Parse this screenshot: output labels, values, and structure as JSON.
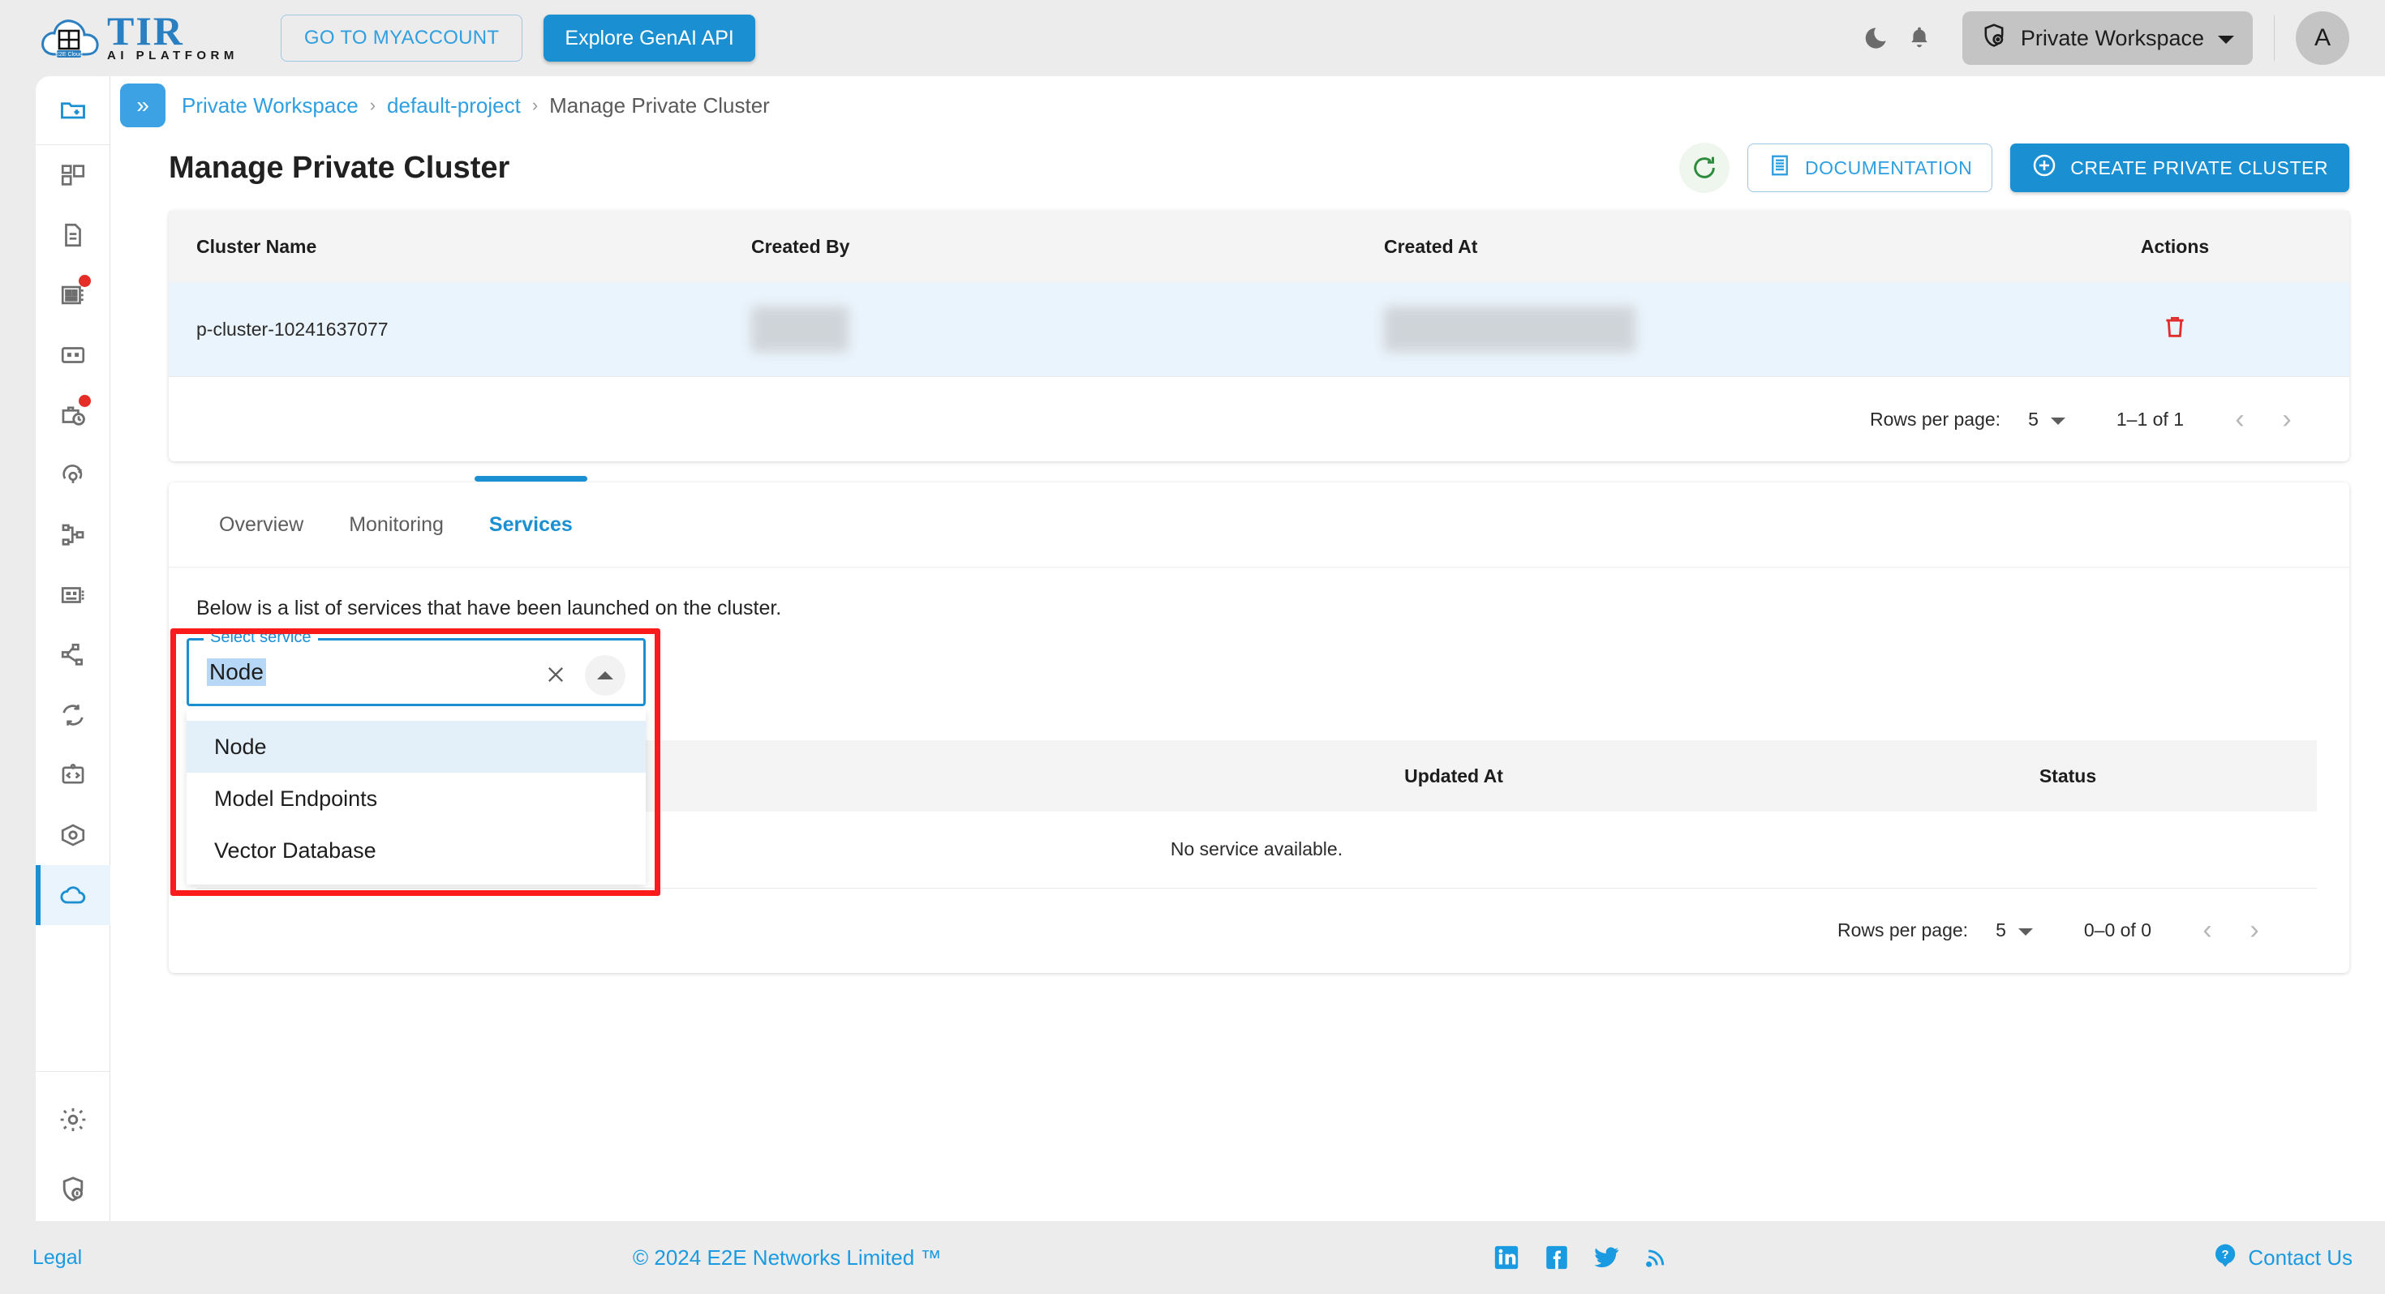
{
  "header": {
    "logo_title": "TIR",
    "logo_subtitle": "AI PLATFORM",
    "logo_badge": "E2E Cloud",
    "myaccount_label": "GO TO MYACCOUNT",
    "genai_label": "Explore GenAI API",
    "workspace_label": "Private Workspace",
    "avatar_initial": "A"
  },
  "breadcrumb": {
    "toggle": "»",
    "workspace": "Private Workspace",
    "project": "default-project",
    "current": "Manage Private Cluster",
    "separator": "›"
  },
  "page": {
    "title": "Manage Private Cluster",
    "documentation_label": "DOCUMENTATION",
    "create_label": "CREATE PRIVATE CLUSTER"
  },
  "cluster_table": {
    "columns": [
      "Cluster Name",
      "Created By",
      "Created At",
      "Actions"
    ],
    "rows": [
      {
        "name": "p-cluster-10241637077",
        "created_by": "",
        "created_at": "",
        "action": "delete-icon"
      }
    ],
    "pager": {
      "rows_per_page_label": "Rows per page:",
      "rows_per_page_value": "5",
      "range": "1–1 of 1"
    }
  },
  "tabs": [
    {
      "label": "Overview",
      "active": false
    },
    {
      "label": "Monitoring",
      "active": false
    },
    {
      "label": "Services",
      "active": true
    }
  ],
  "services": {
    "note": "Below is a list of services that have been launched on the cluster.",
    "select": {
      "legend": "Select service",
      "value": "Node",
      "options": [
        "Node",
        "Model Endpoints",
        "Vector Database"
      ],
      "selected_index": 0
    },
    "table": {
      "columns": [
        "",
        "Updated At",
        "Status"
      ],
      "empty_message": "No service available."
    },
    "pager": {
      "rows_per_page_label": "Rows per page:",
      "rows_per_page_value": "5",
      "range": "0–0 of 0"
    }
  },
  "footer": {
    "legal": "Legal",
    "copyright": "© 2024 E2E Networks Limited ™",
    "contact": "Contact Us",
    "social": [
      "linkedin-icon",
      "facebook-icon",
      "twitter-icon",
      "rss-icon"
    ]
  },
  "colors": {
    "accent": "#1a8fd1",
    "link": "#2f9fe0",
    "danger": "#e12d2d",
    "highlight_border": "#fb1b1b",
    "row_highlight": "#eaf4fc",
    "page_bg": "#ececec"
  }
}
